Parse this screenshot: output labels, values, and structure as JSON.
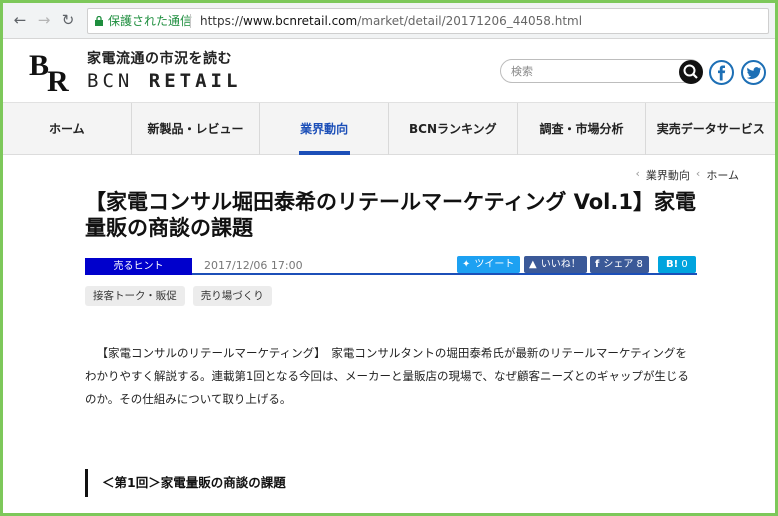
{
  "browser": {
    "secure_label": "保護された通信",
    "url_scheme": "https://",
    "url_host": "www.bcnretail.com",
    "url_path": "/market/detail/20171206_44058.html"
  },
  "header": {
    "logo_letters": "BR",
    "tagline": "家電流通の市況を読む",
    "brand_thin": "BCN",
    "brand_bold": "RETAIL",
    "search_placeholder": "検索"
  },
  "nav": {
    "items": [
      {
        "label": "ホーム"
      },
      {
        "label": "新製品・レビュー"
      },
      {
        "label": "業界動向"
      },
      {
        "label": "BCNランキング"
      },
      {
        "label": "調査・市場分析"
      },
      {
        "label": "実売データサービス"
      }
    ]
  },
  "breadcrumb": {
    "current": "業界動向",
    "home": "ホーム"
  },
  "article": {
    "title": "【家電コンサル堀田泰希のリテールマーケティング Vol.1】家電量販の商談の課題",
    "category": "売るヒント",
    "date": "2017/12/06 17:00",
    "share": {
      "tweet": "ツイート",
      "like": "いいね！",
      "share": "シェア",
      "share_count": "8",
      "hatena": "B!",
      "hatena_count": "0"
    },
    "tags": [
      "接客トーク・販促",
      "売り場づくり"
    ],
    "lead": "【家電コンサルのリテールマーケティング】　家電コンサルタントの堀田泰希氏が最新のリテールマーケティングをわかりやすく解説する。連載第1回となる今回は、メーカーと量販店の現場で、なぜ顧客ニーズとのギャップが生じるのか。その仕組みについて取り上げる。",
    "section_heading": "＜第1回＞家電量販の商談の課題"
  },
  "colors": {
    "accent": "#1c4fb8",
    "badge": "#0000cc",
    "twitter": "#1da1f2",
    "facebook": "#3b5998",
    "hatena": "#00a4de",
    "frame": "#7dc85a"
  }
}
